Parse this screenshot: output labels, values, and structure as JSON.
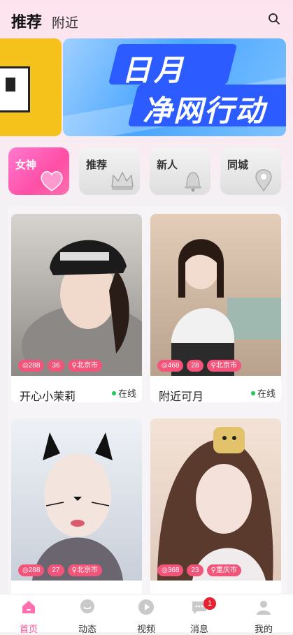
{
  "header": {
    "tabs": [
      {
        "label": "推荐",
        "active": true
      },
      {
        "label": "附近",
        "active": false
      }
    ]
  },
  "banner": {
    "line1": "日月",
    "line2": "净网行动"
  },
  "categories": [
    {
      "label": "女神",
      "icon": "heart-icon",
      "active": true
    },
    {
      "label": "推荐",
      "icon": "crown-icon",
      "active": false
    },
    {
      "label": "新人",
      "icon": "bell-icon",
      "active": false
    },
    {
      "label": "同城",
      "icon": "location-pin-icon",
      "active": false
    }
  ],
  "profiles": [
    {
      "name": "开心小茉莉",
      "views": "288",
      "age": "36",
      "city": "北京市",
      "status": "在线"
    },
    {
      "name": "附近可月",
      "views": "468",
      "age": "28",
      "city": "北京市",
      "status": "在线"
    },
    {
      "views": "288",
      "age": "27",
      "city": "北京市"
    },
    {
      "views": "368",
      "age": "23",
      "city": "重庆市"
    }
  ],
  "tabbar": {
    "items": [
      {
        "label": "首页",
        "icon": "home-icon",
        "active": true
      },
      {
        "label": "动态",
        "icon": "chat-bubble-icon"
      },
      {
        "label": "视频",
        "icon": "play-icon"
      },
      {
        "label": "消息",
        "icon": "message-icon",
        "badge": "1"
      },
      {
        "label": "我的",
        "icon": "user-icon"
      }
    ]
  },
  "colors": {
    "accent": "#ff4f9a",
    "chip": "#f2547a",
    "banner_blue": "#2c5cff",
    "online": "#22c55e"
  }
}
